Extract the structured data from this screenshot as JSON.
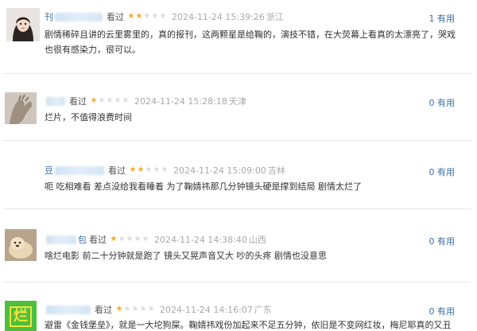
{
  "comments": [
    {
      "username": "刊",
      "watched_label": "看过",
      "rating": 2,
      "time": "2024-11-24 15:39:26",
      "location": "浙江",
      "useful": "1 有用",
      "text": "剧情稀碎且讲的云里雾里的，真的报刊，这两颗星是给鞠的，演技不错，在大荧幕上看真的太漂亮了，哭戏也很有感染力，很可以。"
    },
    {
      "username": "",
      "watched_label": "看过",
      "rating": 1,
      "time": "2024-11-24 15:28:18",
      "location": "天津",
      "useful": "0 有用",
      "text": "烂片，不值得浪费时间"
    },
    {
      "username": "豆",
      "watched_label": "看过",
      "rating": 2,
      "time": "2024-11-24 15:09:00",
      "location": "吉林",
      "useful": "0 有用",
      "text": "呃 吃相难看 差点没给我看睡着 为了鞠婧祎那几分钟镜头硬是撑到结局 剧情太烂了"
    },
    {
      "username": "包",
      "watched_label": "看过",
      "rating": 1,
      "time": "2024-11-24 14:38:40",
      "location": "山西",
      "useful": "0 有用",
      "text": "啥烂电影 前二十分钟就是跑了 镜头又晃声音又大 吵的头疼 剧情也没意思"
    },
    {
      "username": "",
      "watched_label": "看过",
      "rating": 1,
      "time": "2024-11-24 14:16:07",
      "location": "广东",
      "useful": "0 有用",
      "text": "避雷《金钱堡垒》，就是一大坨狗屎。鞠婧祎戏份加起来不足五分钟，依旧是不变网红妆，梅尼耶真的又丑"
    }
  ],
  "avatar5_char": "烂",
  "colors": {
    "link": "#3a6ea5",
    "star_on": "#f6ab2b",
    "star_off": "#dcdcdc",
    "meta_gray": "#aaaaaa"
  }
}
